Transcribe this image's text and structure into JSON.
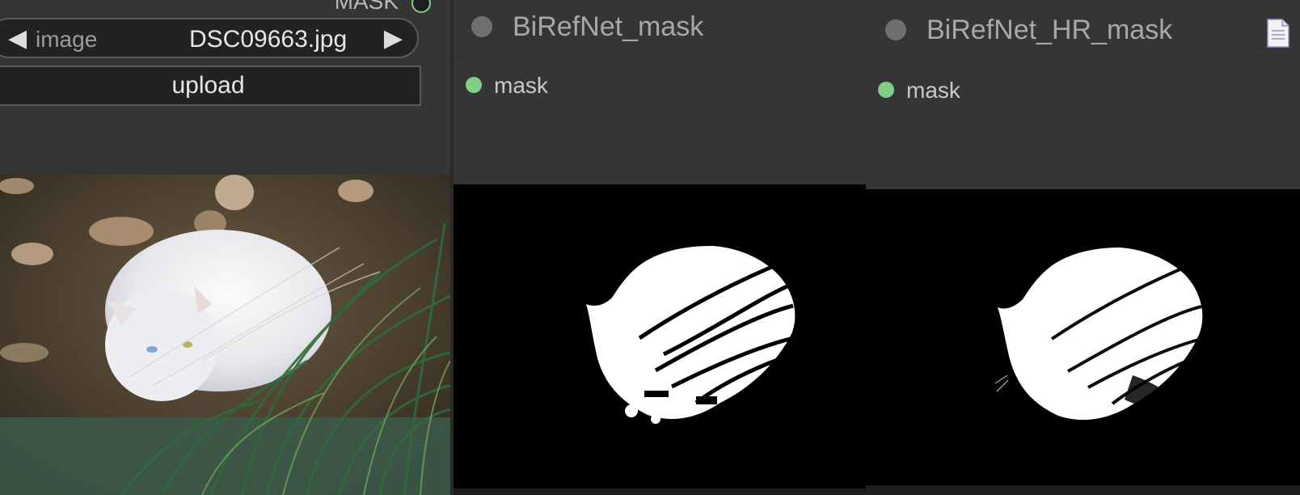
{
  "load_node": {
    "output_label": "MASK",
    "image_widget": {
      "name": "image",
      "value": "DSC09663.jpg",
      "prev_icon": "left-arrow-icon",
      "next_icon": "right-arrow-icon"
    },
    "upload_label": "upload"
  },
  "mask_node": {
    "title": "BiRefNet_mask",
    "output": "mask"
  },
  "hr_node": {
    "title": "BiRefNet_HR_mask",
    "output": "mask",
    "icon": "document-icon"
  },
  "colors": {
    "node_bg": "#353535",
    "canvas_bg": "#1e1e1e",
    "output_dot": "#7fcf85",
    "title_text": "#a8a8a8"
  }
}
